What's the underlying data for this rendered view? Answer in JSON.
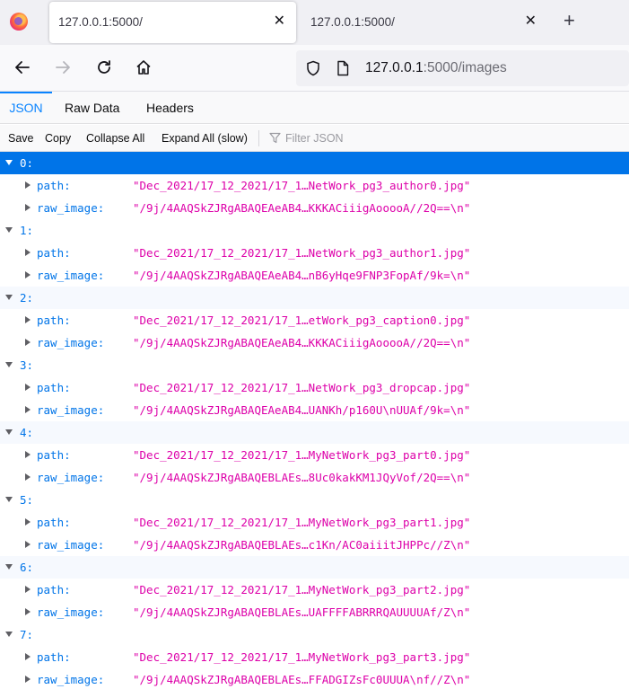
{
  "browser": {
    "tabs": [
      {
        "title": "127.0.0.1:5000/",
        "active": true
      },
      {
        "title": "127.0.0.1:5000/",
        "active": false
      }
    ],
    "close_glyph": "✕",
    "new_tab_glyph": "+",
    "url_host": "127.0.0.1",
    "url_rest": ":5000/images"
  },
  "viewer": {
    "tabs": [
      "JSON",
      "Raw Data",
      "Headers"
    ],
    "selected_tab": "JSON",
    "toolbar": {
      "save": "Save",
      "copy": "Copy",
      "collapse_all": "Collapse All",
      "expand_all": "Expand All (slow)",
      "filter_placeholder": "Filter JSON"
    }
  },
  "items": [
    {
      "index": "0:",
      "path": "\"Dec_2021/17_12_2021/17_1…NetWork_pg3_author0.jpg\"",
      "raw_image": "\"/9j/4AAQSkZJRgABAQEAeAB4…KKKACiiigAooooA//2Q==\\n\""
    },
    {
      "index": "1:",
      "path": "\"Dec_2021/17_12_2021/17_1…NetWork_pg3_author1.jpg\"",
      "raw_image": "\"/9j/4AAQSkZJRgABAQEAeAB4…nB6yHqe9FNP3FopAf/9k=\\n\""
    },
    {
      "index": "2:",
      "path": "\"Dec_2021/17_12_2021/17_1…etWork_pg3_caption0.jpg\"",
      "raw_image": "\"/9j/4AAQSkZJRgABAQEAeAB4…KKKACiiigAooooA//2Q==\\n\""
    },
    {
      "index": "3:",
      "path": "\"Dec_2021/17_12_2021/17_1…NetWork_pg3_dropcap.jpg\"",
      "raw_image": "\"/9j/4AAQSkZJRgABAQEAeAB4…UANKh/p160U\\nUUAf/9k=\\n\""
    },
    {
      "index": "4:",
      "path": "\"Dec_2021/17_12_2021/17_1…MyNetWork_pg3_part0.jpg\"",
      "raw_image": "\"/9j/4AAQSkZJRgABAQEBLAEs…8Uc0kakKM1JQyVof/2Q==\\n\""
    },
    {
      "index": "5:",
      "path": "\"Dec_2021/17_12_2021/17_1…MyNetWork_pg3_part1.jpg\"",
      "raw_image": "\"/9j/4AAQSkZJRgABAQEBLAEs…c1Kn/AC0aiiitJHPPc//Z\\n\""
    },
    {
      "index": "6:",
      "path": "\"Dec_2021/17_12_2021/17_1…MyNetWork_pg3_part2.jpg\"",
      "raw_image": "\"/9j/4AAQSkZJRgABAQEBLAEs…UAFFFFABRRRQAUUUUAf/Z\\n\""
    },
    {
      "index": "7:",
      "path": "\"Dec_2021/17_12_2021/17_1…MyNetWork_pg3_part3.jpg\"",
      "raw_image": "\"/9j/4AAQSkZJRgABAQEBLAEs…FFADGIZsFc0UUUA\\nf//Z\\n\""
    }
  ],
  "keys": {
    "path": "path:",
    "raw_image": "raw_image:"
  },
  "colors": {
    "accent": "#0074e8",
    "string": "#dd00a9",
    "selected_row": "#0074e8"
  }
}
